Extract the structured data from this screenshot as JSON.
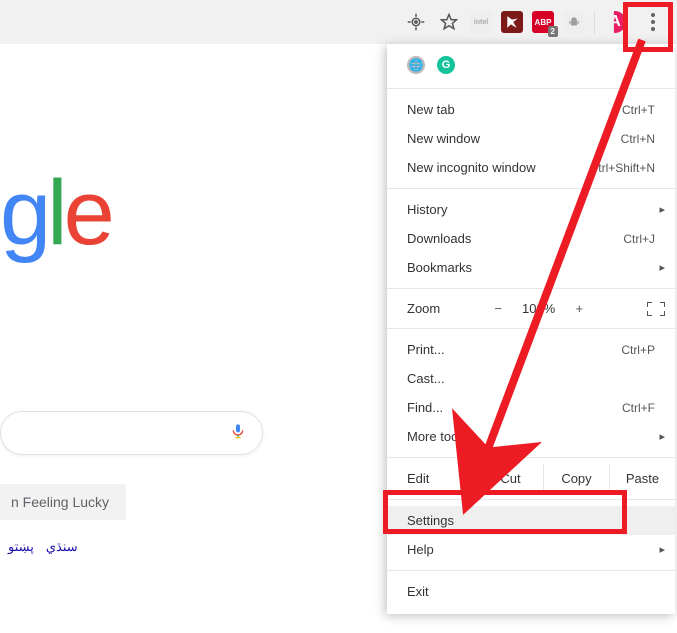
{
  "toolbar": {
    "abp_badge": "2",
    "avatar_letter": "A"
  },
  "search": {
    "lucky_label": "n Feeling Lucky"
  },
  "langs": [
    "سنڌي",
    "پښتو"
  ],
  "menu": {
    "new_tab": {
      "label": "New tab",
      "shortcut": "Ctrl+T"
    },
    "new_window": {
      "label": "New window",
      "shortcut": "Ctrl+N"
    },
    "incognito": {
      "label": "New incognito window",
      "shortcut": "trl+Shift+N"
    },
    "history": {
      "label": "History"
    },
    "downloads": {
      "label": "Downloads",
      "shortcut": "Ctrl+J"
    },
    "bookmarks": {
      "label": "Bookmarks"
    },
    "zoom": {
      "label": "Zoom",
      "value": "100%",
      "minus": "−",
      "plus": "+"
    },
    "print": {
      "label": "Print...",
      "shortcut": "Ctrl+P"
    },
    "cast": {
      "label": "Cast..."
    },
    "find": {
      "label": "Find...",
      "shortcut": "Ctrl+F"
    },
    "more_tools": {
      "label": "More tools"
    },
    "edit": {
      "label": "Edit",
      "cut": "Cut",
      "copy": "Copy",
      "paste": "Paste"
    },
    "settings": {
      "label": "Settings"
    },
    "help": {
      "label": "Help"
    },
    "exit": {
      "label": "Exit"
    }
  }
}
